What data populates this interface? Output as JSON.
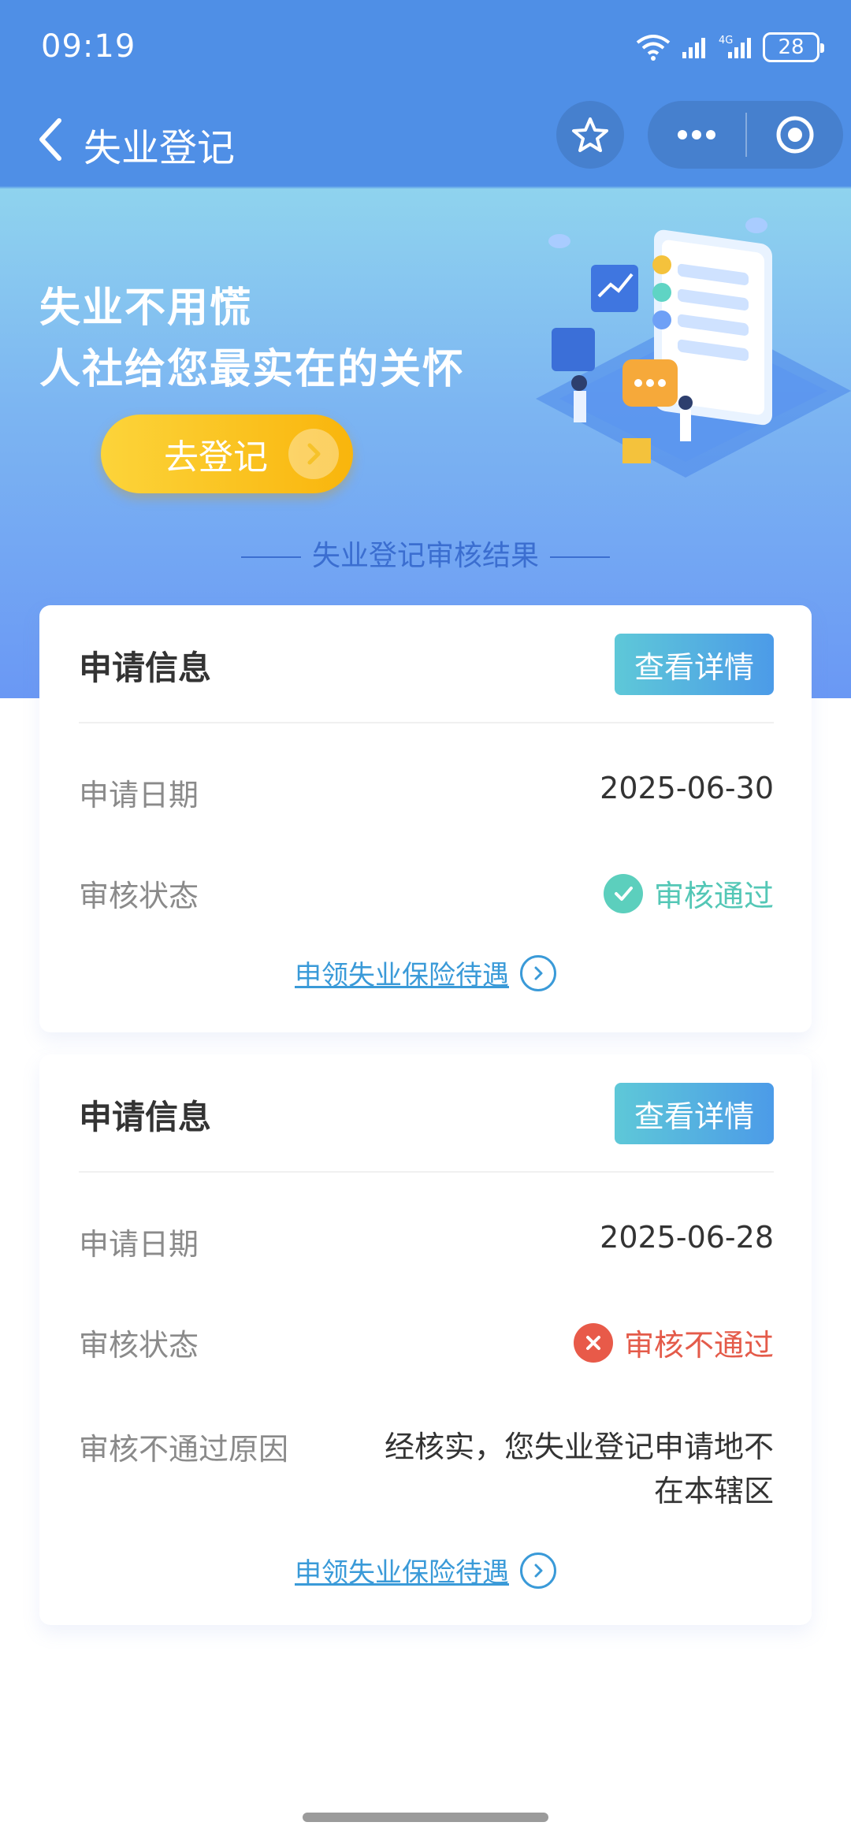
{
  "status_bar": {
    "time": "09:19",
    "network": "4G",
    "battery": "28"
  },
  "nav": {
    "title": "失业登记"
  },
  "banner": {
    "line1": "失业不用慌",
    "line2": "人社给您最实在的关怀",
    "register_button": "去登记"
  },
  "section_title": "失业登记审核结果",
  "cards": [
    {
      "header_title": "申请信息",
      "detail_button": "查看详情",
      "date_label": "申请日期",
      "date_value": "2025-06-30",
      "status_label": "审核状态",
      "status_value": "审核通过",
      "status_color": "#54c7b6",
      "claim_link": "申领失业保险待遇"
    },
    {
      "header_title": "申请信息",
      "detail_button": "查看详情",
      "date_label": "申请日期",
      "date_value": "2025-06-28",
      "status_label": "审核状态",
      "status_value": "审核不通过",
      "status_color": "#e45b4a",
      "reason_label": "审核不通过原因",
      "reason_value": "经核实，您失业登记申请地不在本辖区",
      "claim_link": "申领失业保险待遇"
    }
  ],
  "colors": {
    "header_blue": "#4f8fe6",
    "accent_button": "#f9b50c",
    "link_blue": "#3a9ad8"
  }
}
